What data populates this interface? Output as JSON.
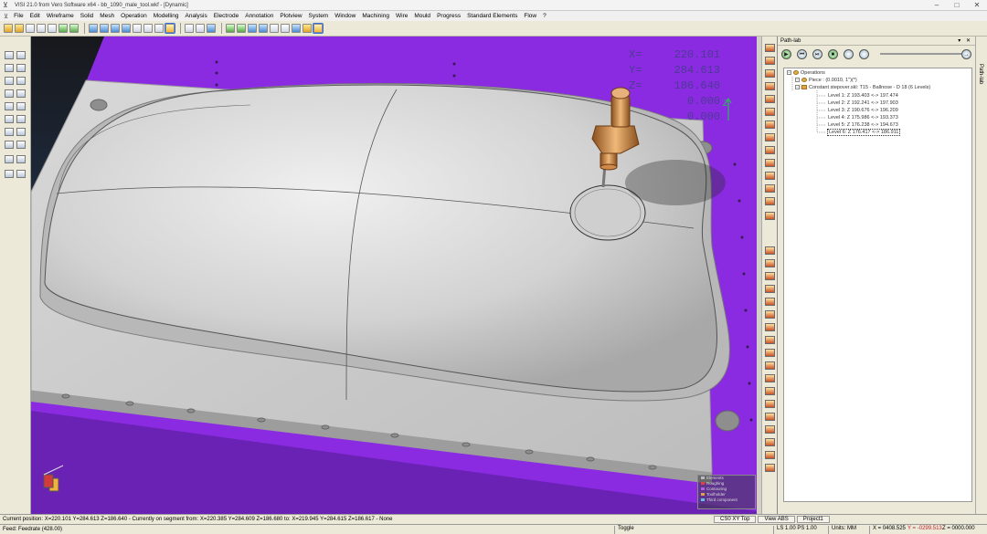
{
  "window": {
    "title": "VISI 21.0 from Vero Software x64 - bb_1090_male_tool.wkf - [Dynamic]",
    "controls": [
      "–",
      "□",
      "✕"
    ]
  },
  "menu": {
    "items": [
      "File",
      "Edit",
      "Wireframe",
      "Solid",
      "Mesh",
      "Operation",
      "Modelling",
      "Analysis",
      "Electrode",
      "Annotation",
      "Plotview",
      "System",
      "Window",
      "Machining",
      "Wire",
      "Mould",
      "Progress",
      "Standard Elements",
      "Flow",
      "?"
    ]
  },
  "toolbar": {
    "icons": [
      "new-icon",
      "open-icon",
      "save-icon",
      "print-icon",
      "copy-icon",
      "undo-icon",
      "redo-icon",
      "zoom-icon",
      "view-front-icon",
      "view-top-icon",
      "view-side-icon",
      "view-iso-icon",
      "shade-icon",
      "wire-icon",
      "hidden-icon",
      "layer-icon",
      "grid-icon",
      "measure-icon",
      "cam-icon",
      "path-icon"
    ]
  },
  "viewport": {
    "readout": {
      "x_label": "X=",
      "x_value": "220.101",
      "y_label": "Y=",
      "y_value": "284.613",
      "z_label": "Z=",
      "z_value": "186.640",
      "a_value": "0.000",
      "b_value": "0.000"
    },
    "axis_label": "Z",
    "legend": [
      "Elements",
      "Roughing",
      "Contouring",
      "Toolholder",
      "Third component"
    ],
    "colors": {
      "background": "#1e1e24",
      "plate": "#8a2be2",
      "part": "#cfcfcf",
      "tool": "#c88a4a"
    }
  },
  "path_lab": {
    "title": "Path-lab",
    "side_label": "Path-lab",
    "buttons": {
      "play": "▶",
      "rewind": "⏮",
      "step": "⏯",
      "stop": "■",
      "forward": "→"
    },
    "tree": [
      {
        "text": "Operations",
        "level": 0
      },
      {
        "text": "Piece : (0.0010, 1\")(*)",
        "level": 1
      },
      {
        "text": "Constant stepover.skl: T15 - Ballnose - D 18 (6 Levels)",
        "level": 1
      },
      {
        "text": "Level 1: Z 193.403 <-> 197.474",
        "level": 2
      },
      {
        "text": "Level 2: Z 192.241 <-> 197.903",
        "level": 2
      },
      {
        "text": "Level 3: Z 190.676 <-> 196.209",
        "level": 2
      },
      {
        "text": "Level 4: Z 175.986 <-> 193.373",
        "level": 2
      },
      {
        "text": "Level 5: Z 176.238 <-> 194.673",
        "level": 2
      },
      {
        "text": "Level 6: Z 176.417 <-> 186.911",
        "level": 2,
        "selected": true
      }
    ]
  },
  "status": {
    "line1": "Current position: X=220.101 Y=284.613 Z=186.640 - Currently on segment from: X=220.385 Y=284.609 Z=186.680 to: X=219.945 Y=284.615 Z=186.617 - None",
    "line2": "Feed: Feedrate (428.00)",
    "cs": "CS0 XY Top",
    "view": "View ABS",
    "project": "Project1",
    "toggle": "Toggle",
    "ls_ps": "LS 1.00 PS 1.00",
    "units": "Units: MM",
    "coord_x": "X = 0408.525",
    "coord_y": "Y = -0299.513",
    "coord_z": "Z = 0000.000"
  }
}
